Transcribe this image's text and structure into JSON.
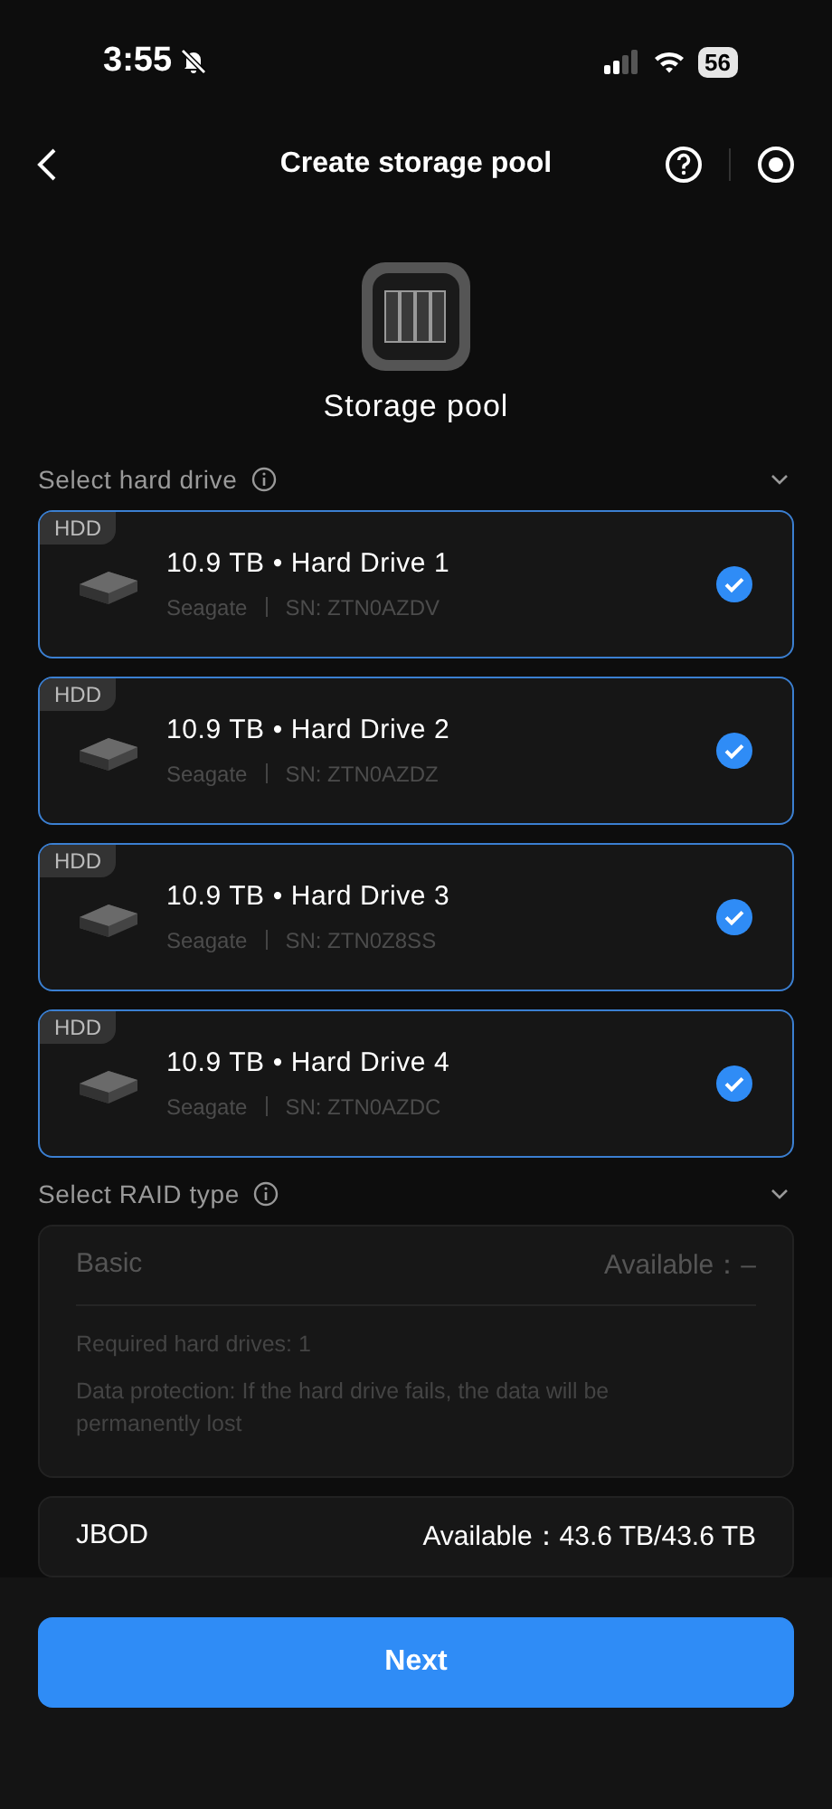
{
  "status_bar": {
    "time": "3:55",
    "battery": "56"
  },
  "header": {
    "title": "Create storage pool"
  },
  "hero": {
    "label": "Storage pool"
  },
  "drive_section": {
    "title": "Select hard drive",
    "expanded": true
  },
  "drives": [
    {
      "tag": "HDD",
      "title": "10.9 TB • Hard Drive 1",
      "brand": "Seagate",
      "serial": "SN: ZTN0AZDV",
      "selected": true
    },
    {
      "tag": "HDD",
      "title": "10.9 TB • Hard Drive 2",
      "brand": "Seagate",
      "serial": "SN: ZTN0AZDZ",
      "selected": true
    },
    {
      "tag": "HDD",
      "title": "10.9 TB • Hard Drive 3",
      "brand": "Seagate",
      "serial": "SN: ZTN0Z8SS",
      "selected": true
    },
    {
      "tag": "HDD",
      "title": "10.9 TB • Hard Drive 4",
      "brand": "Seagate",
      "serial": "SN: ZTN0AZDC",
      "selected": true
    }
  ],
  "raid_section": {
    "title": "Select RAID type",
    "expanded": true
  },
  "raid_types": [
    {
      "name": "Basic",
      "available": "Available：–",
      "disabled": true,
      "details": [
        "Required hard drives: 1",
        "Data protection: If the hard drive fails, the data will be permanently lost"
      ]
    },
    {
      "name": "JBOD",
      "available": "Available：43.6 TB/43.6 TB",
      "disabled": false
    }
  ],
  "footer": {
    "button": "Next"
  }
}
